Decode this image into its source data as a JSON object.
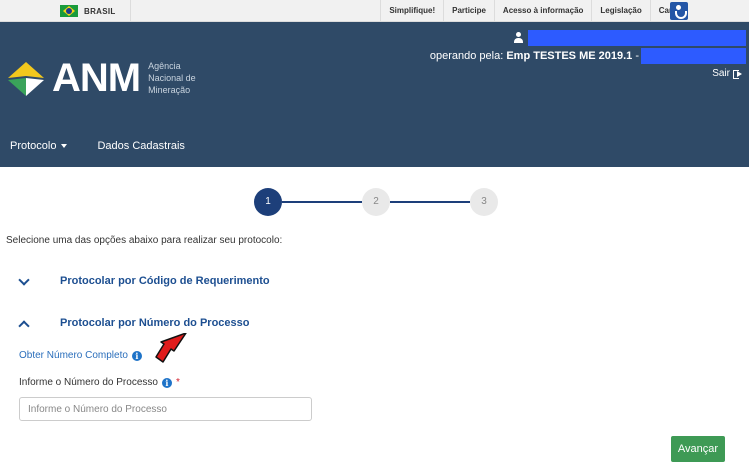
{
  "govbar": {
    "brasil": "BRASIL",
    "links": [
      "Simplifique!",
      "Participe",
      "Acesso à informação",
      "Legislação",
      "Canais"
    ],
    "accessibility_icon": "accessibility-icon"
  },
  "header": {
    "logo_text": "ANM",
    "logo_sub": [
      "Agência",
      "Nacional de",
      "Mineração"
    ],
    "operando_prefix": "operando pela:",
    "operando_company": "Emp TESTES ME 2019.1",
    "operando_suffix": "-",
    "sair": "Sair",
    "colors": {
      "background": "#2f4a67",
      "redaction": "#2d5bff"
    }
  },
  "nav": {
    "items": [
      {
        "label": "Protocolo",
        "has_dropdown": true
      },
      {
        "label": "Dados Cadastrais",
        "has_dropdown": false
      }
    ]
  },
  "stepper": {
    "steps": [
      "1",
      "2",
      "3"
    ],
    "active": 1
  },
  "main": {
    "instruction": "Selecione uma das opções abaixo para realizar seu protocolo:",
    "accordions": [
      {
        "label": "Protocolar por Código de Requerimento",
        "expanded": false
      },
      {
        "label": "Protocolar por Número do Processo",
        "expanded": true
      }
    ],
    "obter_link": "Obter Número Completo",
    "field_label": "Informe o Número do Processo",
    "required_mark": "*",
    "input_placeholder": "Informe o Número do Processo",
    "input_value": "",
    "button_avancar": "Avançar"
  }
}
